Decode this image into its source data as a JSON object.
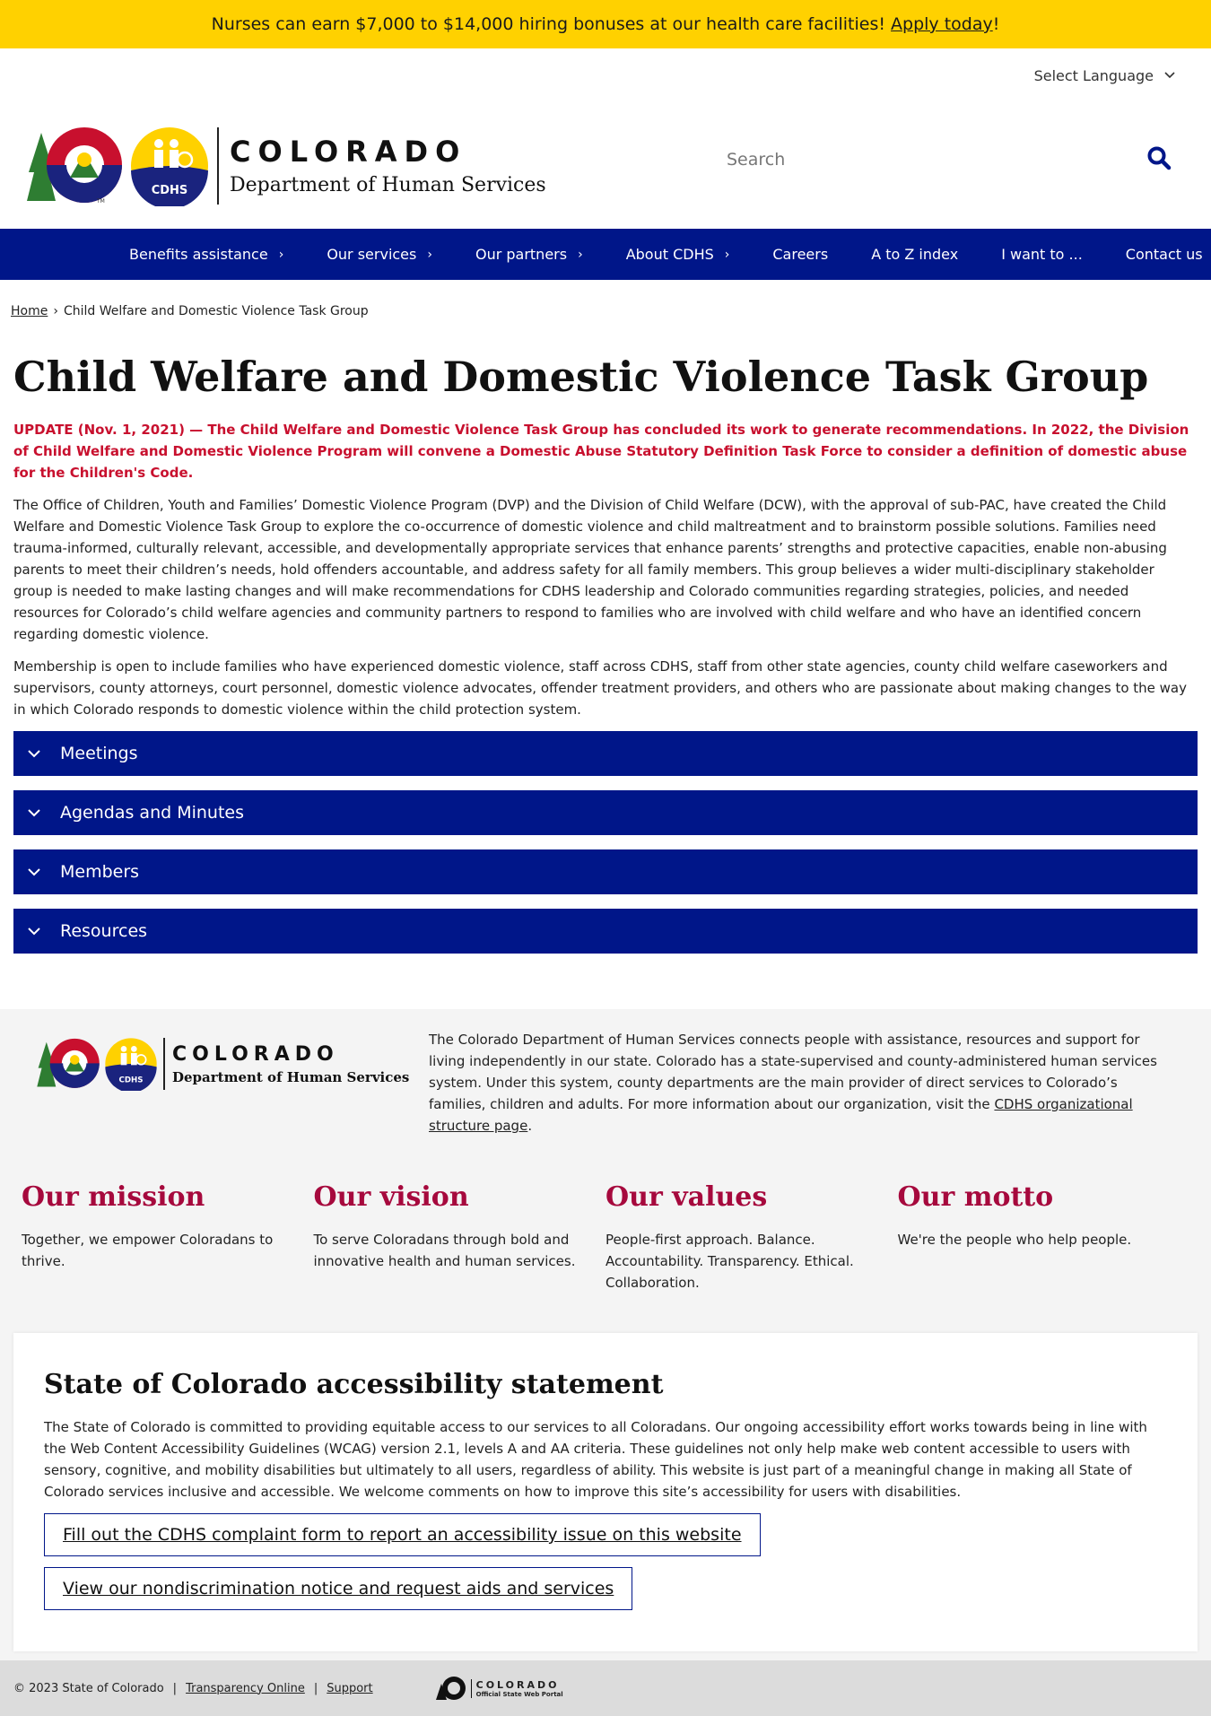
{
  "banner": {
    "text_before": "Nurses can earn $7,000 to $14,000 hiring bonuses at our health care facilities! ",
    "link": "Apply today",
    "text_after": "!"
  },
  "language": {
    "label": "Select Language"
  },
  "header": {
    "logo_state": "COLORADO",
    "logo_dept": "Department of Human Services",
    "logo_badge": "CDHS",
    "search_placeholder": "Search"
  },
  "nav": {
    "items": [
      {
        "label": "Benefits assistance"
      },
      {
        "label": "Our services"
      },
      {
        "label": "Our partners"
      },
      {
        "label": "About CDHS"
      },
      {
        "label": "Careers"
      },
      {
        "label": "A to Z index"
      },
      {
        "label": "I want to ..."
      },
      {
        "label": "Contact us"
      }
    ]
  },
  "breadcrumb": {
    "home": "Home",
    "current": "Child Welfare and Domestic Violence Task Group"
  },
  "main": {
    "title": "Child Welfare and Domestic Violence Task Group",
    "update": "UPDATE (Nov. 1, 2021) — The Child Welfare and Domestic Violence Task Group has concluded its work to generate recommendations. In 2022, the Division of Child Welfare and Domestic Violence Program will convene a Domestic Abuse Statutory Definition Task Force to consider a definition of domestic abuse for the Children's Code.",
    "para1": "The Office of Children, Youth and Families’ Domestic Violence Program (DVP) and the Division of Child Welfare (DCW), with the approval of sub-PAC, have created the Child Welfare and Domestic Violence Task Group to explore the co-occurrence of domestic violence and child maltreatment and to brainstorm possible solutions. Families need trauma-informed, culturally relevant, accessible, and developmentally appropriate services that enhance parents’ strengths and protective capacities, enable non-abusing parents to meet their children’s needs, hold offenders accountable, and address safety for all family members. This group believes a wider multi-disciplinary stakeholder group is needed to make lasting changes and will make recommendations for CDHS leadership and Colorado communities regarding strategies, policies, and needed resources for Colorado’s child welfare agencies and community partners to respond to families who are involved with child welfare and who have an identified concern regarding domestic violence.",
    "para2": "Membership is open to include families who have experienced domestic violence, staff across CDHS, staff from other state agencies, county child welfare caseworkers and supervisors, county attorneys, court personnel, domestic violence advocates, offender treatment providers, and others who are passionate about making changes to the way in which Colorado responds to domestic violence within the child protection system.",
    "accordions": [
      {
        "label": "Meetings"
      },
      {
        "label": "Agendas and Minutes"
      },
      {
        "label": "Members"
      },
      {
        "label": "Resources"
      }
    ]
  },
  "footer": {
    "description": "The Colorado Department of Human Services connects people with assistance, resources and support for living independently in our state. Colorado has a state-supervised and county-administered human services system. Under this system, county departments are the main provider of direct services to Colorado’s families, children and adults. For more information about our organization, visit the ",
    "description_link": "CDHS organizational structure page",
    "description_end": ".",
    "values": [
      {
        "heading": "Our mission",
        "text": "Together, we empower Coloradans to thrive."
      },
      {
        "heading": "Our vision",
        "text": "To serve Coloradans through bold and innovative health and human services."
      },
      {
        "heading": "Our values",
        "text": "People-first approach. Balance. Accountability. Transparency. Ethical. Collaboration."
      },
      {
        "heading": "Our motto",
        "text": "We're the people who help people."
      }
    ]
  },
  "accessibility": {
    "title": "State of Colorado accessibility statement",
    "text": "The State of Colorado is committed to providing equitable access to our services to all Coloradans. Our ongoing accessibility effort works towards being in line with the Web Content Accessibility Guidelines (WCAG) version 2.1, levels A and AA criteria. These guidelines not only help make web content accessible to users with sensory, cognitive, and mobility disabilities but ultimately to all users, regardless of ability. This website is just part of a meaningful change in making all State of Colorado services inclusive and accessible. We welcome comments on how to improve this site’s accessibility for users with disabilities.",
    "button1": "Fill out the CDHS complaint form to report an accessibility issue on this website",
    "button2": "View our nondiscrimination notice and request aids and services"
  },
  "bottom": {
    "copyright": "© 2023 State of Colorado",
    "link1": "Transparency Online",
    "link2": "Support",
    "portal_name": "COLORADO",
    "portal_sub": "Official State Web Portal"
  },
  "colors": {
    "banner": "#ffd100",
    "nav": "#001689",
    "update_red": "#c8102e",
    "heading_maroon": "#a6093d"
  }
}
